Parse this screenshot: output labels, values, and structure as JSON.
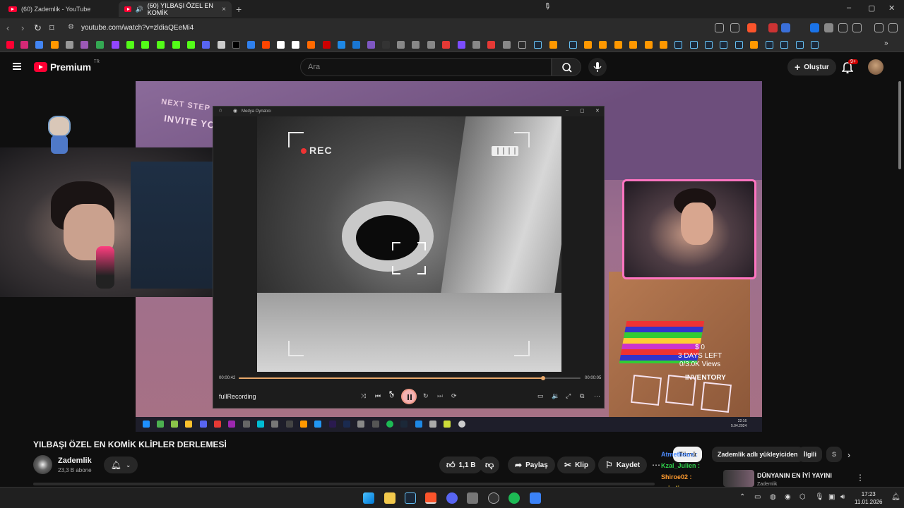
{
  "browser": {
    "tabs": [
      {
        "title": "(60) Zademlik - YouTube",
        "active": false
      },
      {
        "title": "(60) YILBAŞI ÖZEL EN KOMİK",
        "active": true
      }
    ],
    "close_glyph": "×",
    "new_tab_glyph": "+",
    "url": "youtube.com/watch?v=zldiaQEeMi4",
    "window_controls": {
      "minimize": "–",
      "maximize": "▢",
      "close": "✕"
    }
  },
  "youtube": {
    "logo_text": "Premium",
    "logo_country": "TR",
    "search_placeholder": "Ara",
    "create_label": "Oluştur",
    "notification_count": "9+"
  },
  "stream_overlay": {
    "next_step": "NEXT STEP",
    "invite": "INVITE YO",
    "days_left_1": "$ 0",
    "days_left_2": "3 DAYS LEFT",
    "days_left_3": "0/3.0K Views",
    "inventory": "INVENTORY"
  },
  "media_player": {
    "title": "Medya Oynatıcı",
    "rec_label": "REC",
    "time_elapsed": "00:00:42",
    "time_total": "00:00:05",
    "progress_fraction": 0.89,
    "file_name": "fullRecording"
  },
  "inner_taskbar": {
    "time": "22:16",
    "date": "5.04.2024"
  },
  "video": {
    "title": "YILBAŞI ÖZEL EN KOMİK KLİPLER DERLEMESİ",
    "channel": "Zademlik",
    "subscribers": "23,3 B abone",
    "likes": "1,1 B",
    "share_label": "Paylaş",
    "clip_label": "Klip",
    "save_label": "Kaydet"
  },
  "chips": [
    {
      "label": "Tümü"
    },
    {
      "label": "Zademlik adlı yükleyiciden"
    },
    {
      "label": "İlgili"
    },
    {
      "label": "S"
    }
  ],
  "chat": [
    {
      "user": "Atmetheus :",
      "color": "#4d8cff"
    },
    {
      "user": "Kzal_Julien :",
      "color": "#2fcf4b"
    },
    {
      "user": "Shiroe02 :",
      "color": "#ff9b2f"
    },
    {
      "user": "oziodium :",
      "color": "#ffd43b"
    }
  ],
  "recommended": {
    "title": "DÜNYANIN EN İYİ YAYINI",
    "channel": "Zademlik"
  },
  "os_taskbar": {
    "time": "17:23",
    "date": "11.01.2026"
  }
}
